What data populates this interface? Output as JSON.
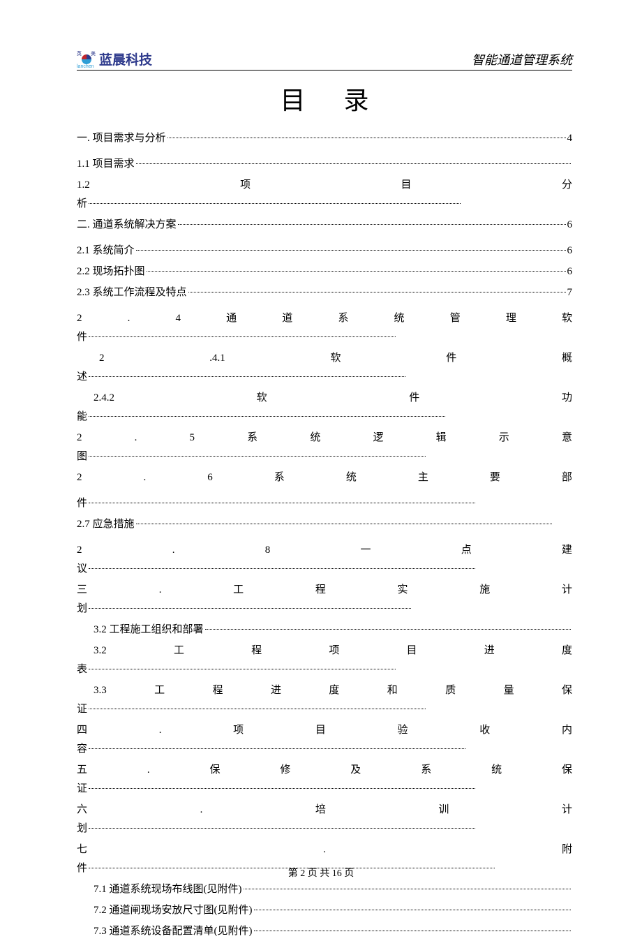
{
  "header": {
    "company_name": "蓝晨科技",
    "logo_pinyin": "lanchen",
    "doc_title": "智能通道管理系统"
  },
  "title": "目录",
  "toc": {
    "s1": {
      "label": "一. 项目需求与分析",
      "page": "4"
    },
    "s1_1": {
      "label": "1.1 项目需求",
      "page": ""
    },
    "s1_2": {
      "chars": [
        "1.2",
        "项",
        "目",
        "分"
      ],
      "cont": "析"
    },
    "s2": {
      "label": "二. 通道系统解决方案",
      "page": "6"
    },
    "s2_1": {
      "label": "2.1 系统简介",
      "page": "6"
    },
    "s2_2": {
      "label": "2.2 现场拓扑图",
      "page": "6"
    },
    "s2_3": {
      "label": "2.3 系统工作流程及特点",
      "page": "7"
    },
    "s2_4": {
      "chars": [
        "2",
        ".",
        "4",
        "通",
        "道",
        "系",
        "统",
        "管",
        "理",
        "软"
      ],
      "cont": "件"
    },
    "s2_4_1": {
      "chars": [
        "2",
        ".4.1",
        "软",
        "件",
        "概"
      ],
      "cont": "述"
    },
    "s2_4_2": {
      "chars": [
        "2.4.2",
        "软",
        "件",
        "功"
      ],
      "cont": "能"
    },
    "s2_5": {
      "chars": [
        "2",
        ".",
        "5",
        "系",
        "统",
        "逻",
        "辑",
        "示",
        "意"
      ],
      "cont": "图"
    },
    "s2_6": {
      "chars": [
        "2",
        ".",
        "6",
        "系",
        "统",
        "主",
        "要",
        "部"
      ],
      "cont": "件"
    },
    "s2_7": {
      "label": "2.7 应急措施"
    },
    "s2_8": {
      "chars": [
        "2",
        ".",
        "8",
        "一",
        "点",
        "建"
      ],
      "cont": "议"
    },
    "s3": {
      "chars": [
        "三",
        ".",
        "工",
        "程",
        "实",
        "施",
        "计"
      ],
      "cont": "划"
    },
    "s3_2a": {
      "label": "3.2 工程施工组织和部署"
    },
    "s3_2b": {
      "chars": [
        "3.2",
        "工",
        "程",
        "项",
        "目",
        "进",
        "度"
      ],
      "cont": "表"
    },
    "s3_3": {
      "chars": [
        "3.3",
        "工",
        "程",
        "进",
        "度",
        "和",
        "质",
        "量",
        "保"
      ],
      "cont": "证"
    },
    "s4": {
      "chars": [
        "四",
        ".",
        "项",
        "目",
        "验",
        "收",
        "内"
      ],
      "cont": "容"
    },
    "s5": {
      "chars": [
        "五",
        ".",
        "保",
        "修",
        "及",
        "系",
        "统",
        "保"
      ],
      "cont": "证"
    },
    "s6": {
      "chars": [
        "六",
        ".",
        "培",
        "训",
        "计"
      ],
      "cont": "划"
    },
    "s7": {
      "chars": [
        "七",
        ".",
        "附"
      ],
      "cont": "件"
    },
    "s7_1": {
      "label": "7.1 通道系统现场布线图(见附件)"
    },
    "s7_2": {
      "label": "7.2 通道闸现场安放尺寸图(见附件)"
    },
    "s7_3": {
      "label": "7.3 通道系统设备配置清单(见附件)"
    }
  },
  "footer": {
    "prefix": "第",
    "current": "2",
    "mid": "页 共",
    "total": "16",
    "suffix": "页"
  }
}
